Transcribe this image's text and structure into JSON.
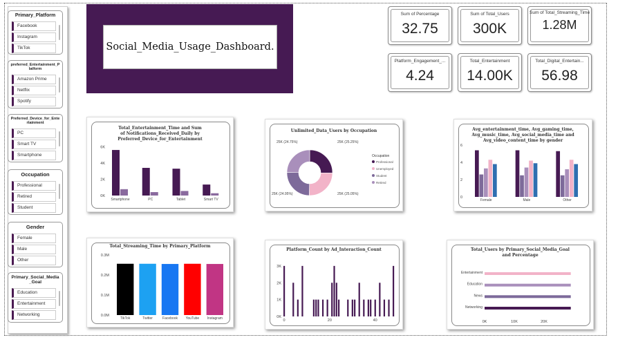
{
  "title": "Social_Media_Usage_Dashboard.",
  "slicers": [
    {
      "title": "Primary_Platform",
      "items": [
        "Facebook",
        "Instagram",
        "TikTok"
      ]
    },
    {
      "title": "preferred_Entertainment_Platform",
      "items": [
        "Amazon Prime",
        "Netflix",
        "Spotify"
      ]
    },
    {
      "title": "Preferred_Device_for_Entertainment",
      "items": [
        "PC",
        "Smart TV",
        "Smartphone"
      ]
    },
    {
      "title": "Occupation",
      "items": [
        "Professional",
        "Retired",
        "Student"
      ]
    },
    {
      "title": "Gender",
      "items": [
        "Female",
        "Male",
        "Other"
      ]
    },
    {
      "title": "Primary_Social_Media_Goal",
      "items": [
        "Education",
        "Entertainment",
        "Networking"
      ]
    }
  ],
  "kpis": [
    {
      "label": "Sum of Percentage",
      "value": "32.75"
    },
    {
      "label": "Sum of Total_Users",
      "value": "300K"
    },
    {
      "label": "Sum of Total_Streaming_Time",
      "value": "1.28M"
    },
    {
      "label": "Platform_Engagement_...",
      "value": "4.24"
    },
    {
      "label": "Total_Entertainment",
      "value": "14.00K"
    },
    {
      "label": "Total_Digital_Entertain...",
      "value": "56.98"
    }
  ],
  "colors": {
    "purple": "#461a53",
    "accent_mid": "#8a6a9e",
    "pink": "#e9a6c2",
    "blue": "#2f6fb0"
  },
  "charts": {
    "c1_title": "Total_Entertainment_Time and Sum of Notifications_Received_Daily by Preferred_Device_for_Entertainment",
    "c2_title": "Unlimited_Data_Users by Occupation",
    "c3_title": "Avg_entertainment_time, Avg_gaming_time, Avg_music_time, Avg_social_media_time and Avg_video_content_time by gender",
    "c4_title": "Total_Streaming_Time by Primary_Platform",
    "c5_title": "Platform_Count by Ad_Interaction_Count",
    "c6_title": "Total_Users by Primary_Social_Media_Goal and Percentage",
    "c2_legend_title": "Occupation"
  },
  "chart_data": [
    {
      "type": "bar",
      "title": "Total_Entertainment_Time and Sum of Notifications_Received_Daily by Preferred_Device_for_Entertainment",
      "categories": [
        "Smartphone",
        "PC",
        "Tablet",
        "Smart TV"
      ],
      "series": [
        {
          "values": [
            5600,
            3400,
            3300,
            1350
          ],
          "color": "#461a53"
        },
        {
          "values": [
            780,
            420,
            560,
            280
          ],
          "color": "#8a6a9e"
        }
      ],
      "yticks": [
        "0K",
        "2K",
        "4K",
        "6K"
      ],
      "ylim": [
        0,
        6200
      ]
    },
    {
      "type": "pie",
      "title": "Unlimited_Data_Users by Occupation",
      "legend_title": "Occupation",
      "slices": [
        {
          "name": "Professional",
          "value": 25.25,
          "label": "25K (25.25%)",
          "color": "#461a53"
        },
        {
          "name": "Unemployed",
          "value": 25.05,
          "label": "25K (25.05%)",
          "color": "#f2b3c8"
        },
        {
          "name": "Student",
          "value": 24.95,
          "label": "25K (24.95%)",
          "color": "#7d6a9a"
        },
        {
          "name": "Retired",
          "value": 24.75,
          "label": "25K (24.75%)",
          "color": "#a98fbb"
        }
      ]
    },
    {
      "type": "bar",
      "title": "Avg_entertainment_time, Avg_gaming_time, Avg_music_time, Avg_social_media_time and Avg_video_content_time by gender",
      "categories": [
        "Female",
        "Male",
        "Other"
      ],
      "series": [
        {
          "values": [
            5.4,
            5.4,
            5.3
          ],
          "color": "#461a53"
        },
        {
          "values": [
            2.6,
            2.5,
            2.5
          ],
          "color": "#7d6a9a"
        },
        {
          "values": [
            3.3,
            3.4,
            3.2
          ],
          "color": "#a98fbb"
        },
        {
          "values": [
            4.3,
            4.2,
            4.3
          ],
          "color": "#f2b3c8"
        },
        {
          "values": [
            3.8,
            3.9,
            3.8
          ],
          "color": "#2f6fb0"
        }
      ],
      "yticks": [
        "0",
        "2",
        "4",
        "6"
      ],
      "ylim": [
        0,
        6
      ]
    },
    {
      "type": "bar",
      "title": "Total_Streaming_Time by Primary_Platform",
      "categories": [
        "TikTok",
        "Twitter",
        "Facebook",
        "YouTube",
        "Instagram"
      ],
      "values": [
        0.256,
        0.256,
        0.255,
        0.256,
        0.255
      ],
      "colors": [
        "#000000",
        "#1da1f2",
        "#1877f2",
        "#ff0000",
        "#c13584"
      ],
      "yticks": [
        "0.0M",
        "0.1M",
        "0.2M",
        "0.3M"
      ],
      "ylim": [
        0,
        0.3
      ]
    },
    {
      "type": "bar",
      "title": "Platform_Count by Ad_Interaction_Count",
      "x": [
        0,
        4,
        6,
        8,
        13,
        14,
        15,
        17,
        19,
        21,
        22,
        23,
        24,
        28,
        30,
        31,
        33,
        35,
        37,
        38,
        40,
        42,
        44,
        46,
        48
      ],
      "values": [
        3,
        2,
        1,
        3,
        1,
        1,
        1,
        1,
        1,
        2,
        3,
        2,
        1,
        1,
        1,
        1,
        2,
        1,
        1,
        1,
        1,
        2,
        1,
        1,
        3
      ],
      "xticks": [
        "0",
        "20",
        "40"
      ],
      "yticks": [
        "0K",
        "1K",
        "2K",
        "3K"
      ],
      "ylim": [
        0,
        3.2
      ]
    },
    {
      "type": "bar",
      "title": "Total_Users by Primary_Social_Media_Goal and Percentage",
      "categories": [
        "Entertainment",
        "Education",
        "News",
        "Networking"
      ],
      "values": [
        29,
        29,
        29,
        29
      ],
      "colors": [
        "#f2b3c8",
        "#a98fbb",
        "#7d6a9a",
        "#461a53"
      ],
      "xticks": [
        "0K",
        "10K",
        "20K"
      ],
      "xlim": [
        0,
        30
      ]
    }
  ]
}
